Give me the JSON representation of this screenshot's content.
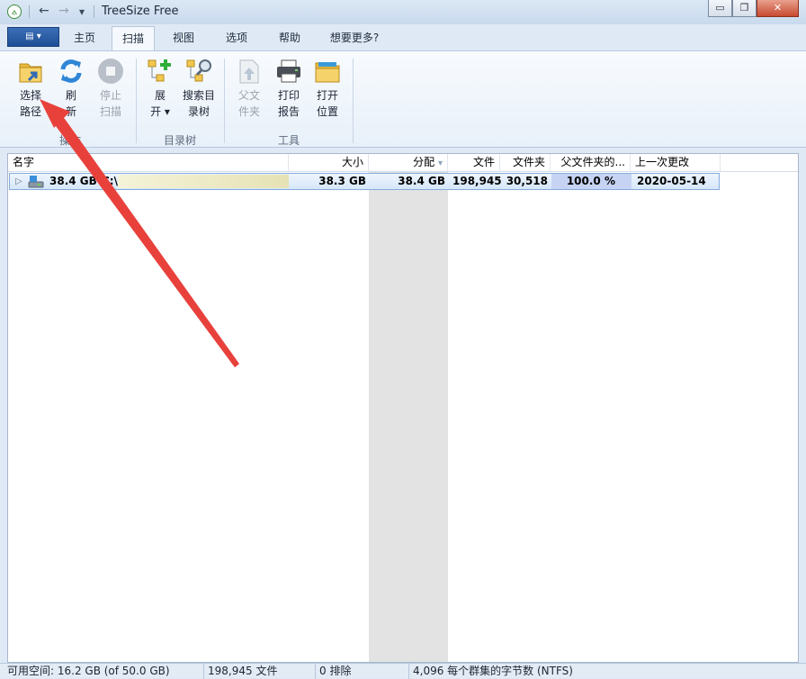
{
  "window": {
    "title": "TreeSize Free",
    "minimize_glyph": "▭",
    "restore_glyph": "❐",
    "close_glyph": "✕"
  },
  "quick_access": {
    "back_glyph": "←",
    "forward_glyph": "→",
    "menu_glyph": "▾"
  },
  "ribbon_tabs": {
    "file_glyph": "▤ ▾",
    "tabs": [
      "主页",
      "扫描",
      "视图",
      "选项",
      "帮助",
      "想要更多?"
    ],
    "active": "扫描"
  },
  "ribbon": {
    "groups": [
      {
        "label": "操作"
      },
      {
        "label": "目录树"
      },
      {
        "label": "工具"
      }
    ],
    "buttons": {
      "select_path": {
        "line1": "选择",
        "line2": "路径",
        "icon": "folder-arrow-icon"
      },
      "refresh": {
        "line1": "刷",
        "line2": "新",
        "icon": "refresh-icon"
      },
      "stop_scan": {
        "line1": "停止",
        "line2": "扫描",
        "icon": "stop-icon"
      },
      "expand": {
        "line1": "展",
        "line2": "开 ▾",
        "icon": "expand-tree-icon"
      },
      "search_dir": {
        "line1": "搜索目",
        "line2": "录树",
        "icon": "search-tree-icon"
      },
      "parent_folder": {
        "line1": "父文",
        "line2": "件夹",
        "icon": "parent-folder-icon"
      },
      "print_report": {
        "line1": "打印",
        "line2": "报告",
        "icon": "printer-icon"
      },
      "open_location": {
        "line1": "打开",
        "line2": "位置",
        "icon": "open-folder-icon"
      }
    }
  },
  "table": {
    "columns": [
      "名字",
      "大小",
      "分配",
      "文件",
      "文件夹",
      "父文件夹的...",
      "上一次更改"
    ],
    "sort_glyph": "▾",
    "rows": [
      {
        "expander": "▷",
        "size_label": "38.4 GB",
        "name": "C:\\",
        "size": "38.3 GB",
        "allocated": "38.4 GB",
        "files": "198,945",
        "folders": "30,518",
        "percent_of_parent": "100.0 %",
        "last_change": "2020-05-14"
      }
    ],
    "bar_fill_percent": 100
  },
  "status": {
    "free_space": "可用空间: 16.2 GB  (of 50.0 GB)",
    "files": "198,945 文件",
    "excluded": "0 排除",
    "cluster": "4,096 每个群集的字节数 (NTFS)"
  },
  "colors": {
    "accent": "#2f6ab5",
    "selection": "#d6e7fa",
    "annotation_arrow": "#e8413c"
  }
}
